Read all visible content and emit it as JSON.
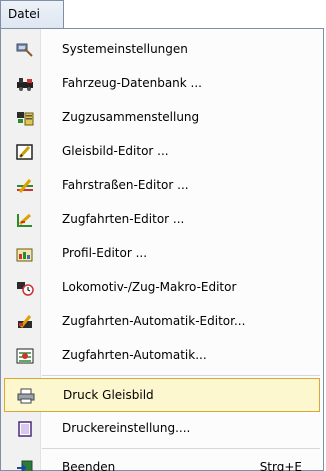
{
  "menubar": {
    "title": "Datei"
  },
  "menu": {
    "items": [
      {
        "label": "Systemeinstellungen",
        "icon": "settings-icon"
      },
      {
        "label": "Fahrzeug-Datenbank ...",
        "icon": "locomotive-icon"
      },
      {
        "label": "Zugzusammenstellung",
        "icon": "train-composition-icon"
      },
      {
        "label": "Gleisbild-Editor ...",
        "icon": "track-editor-icon"
      },
      {
        "label": "Fahrstraßen-Editor ...",
        "icon": "route-editor-icon"
      },
      {
        "label": "Zugfahrten-Editor ...",
        "icon": "train-run-editor-icon"
      },
      {
        "label": "Profil-Editor ...",
        "icon": "profile-editor-icon"
      },
      {
        "label": "Lokomotiv-/Zug-Makro-Editor",
        "icon": "macro-editor-icon"
      },
      {
        "label": "Zugfahrten-Automatik-Editor...",
        "icon": "automatic-editor-icon"
      },
      {
        "label": "Zugfahrten-Automatik...",
        "icon": "automatic-icon"
      },
      {
        "label": "Druck Gleisbild",
        "icon": "printer-icon",
        "highlighted": true
      },
      {
        "label": "Druckereinstellung....",
        "icon": "printer-settings-icon"
      },
      {
        "label": "Beenden",
        "icon": "exit-icon",
        "shortcut": "Strg+E"
      }
    ]
  },
  "colors": {
    "highlight_bg": "#fdf7d0",
    "highlight_border": "#d9a733",
    "menu_border": "#7f8fa6"
  }
}
